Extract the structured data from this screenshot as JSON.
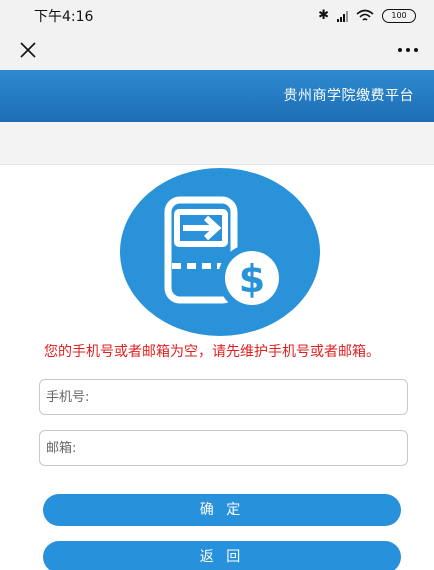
{
  "status_bar": {
    "time": "下午4:16",
    "battery": "100",
    "icons": [
      "bluetooth-icon",
      "signal-icon",
      "wifi-icon",
      "battery-icon"
    ]
  },
  "nav": {
    "close_icon": "close-icon",
    "more_icon": "more-icon"
  },
  "header": {
    "title": "贵州商学院缴费平台"
  },
  "logo": {
    "icon": "payment-card-dollar-icon"
  },
  "form": {
    "error_message": "您的手机号或者邮箱为空，请先维护手机号或者邮箱。",
    "phone": {
      "placeholder": "手机号:",
      "value": ""
    },
    "email": {
      "placeholder": "邮箱:",
      "value": ""
    }
  },
  "buttons": {
    "confirm_label": "确 定",
    "back_label": "返 回"
  },
  "colors": {
    "accent": "#2891db",
    "header": "#1c6eb4",
    "error": "#e02020"
  }
}
